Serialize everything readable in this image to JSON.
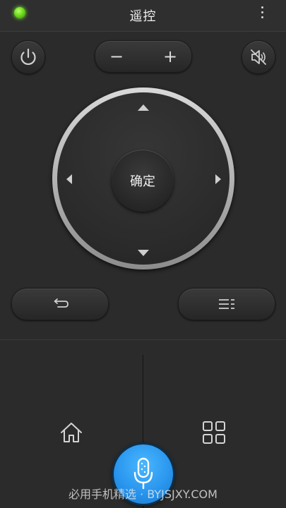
{
  "header": {
    "title": "遥控",
    "status_color": "#6fdb1e"
  },
  "icons": {
    "status": "status-dot-icon",
    "more": "more-vertical-icon",
    "power": "power-icon",
    "mute": "volume-mute-icon",
    "back": "back-icon",
    "menu": "menu-icon",
    "home": "home-icon",
    "apps": "apps-grid-icon",
    "mic": "microphone-icon"
  },
  "controls": {
    "volume_minus": "−",
    "volume_plus": "+",
    "ok_label": "确定"
  },
  "watermark": "必用手机精选 · BYJSJXY.COM",
  "colors": {
    "background": "#2b2b2b",
    "mic_accent": "#2a96ee",
    "ring": "#bdbdbd"
  }
}
